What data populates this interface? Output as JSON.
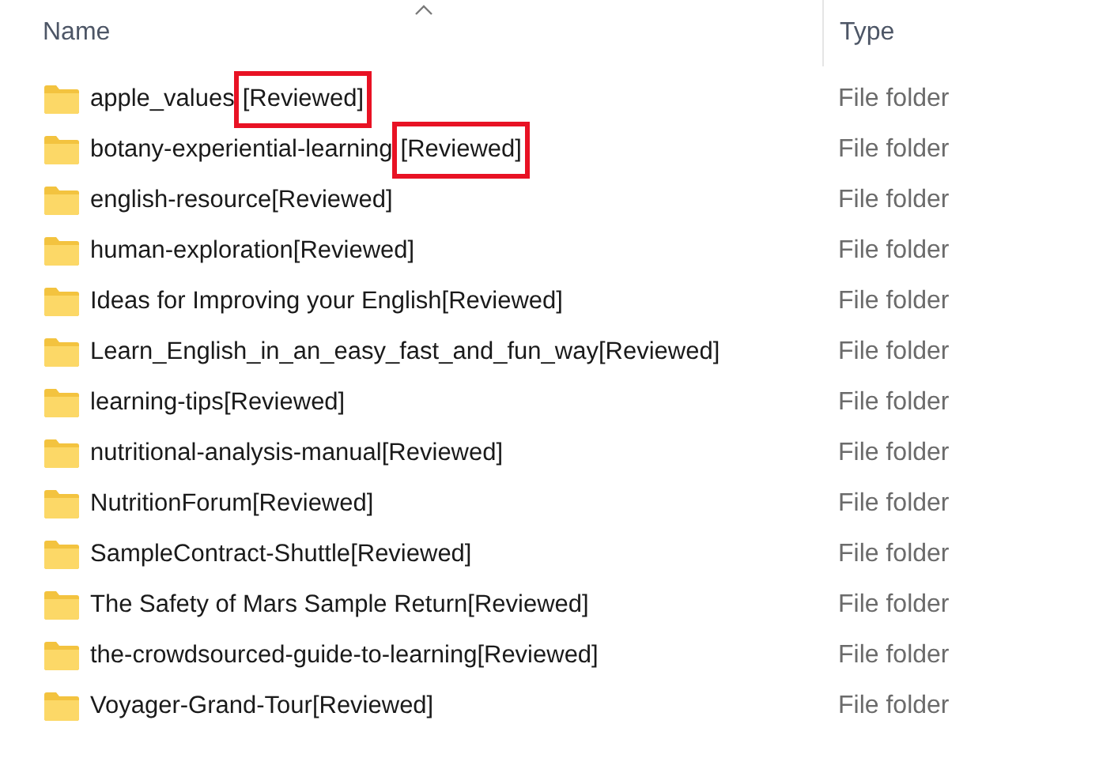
{
  "columns": [
    {
      "label": "Name",
      "sorted": true
    },
    {
      "label": "Type",
      "sorted": false
    }
  ],
  "rows": [
    {
      "name": "apple_values",
      "tag": "[Reviewed]",
      "type": "File folder",
      "highlighted": true
    },
    {
      "name": "botany-experiential-learning",
      "tag": "[Reviewed]",
      "type": "File folder",
      "highlighted": true
    },
    {
      "name": "english-resource",
      "tag": "[Reviewed]",
      "type": "File folder",
      "highlighted": false
    },
    {
      "name": "human-exploration",
      "tag": "[Reviewed]",
      "type": "File folder",
      "highlighted": false
    },
    {
      "name": "Ideas for Improving your English",
      "tag": "[Reviewed]",
      "type": "File folder",
      "highlighted": false
    },
    {
      "name": "Learn_English_in_an_easy_fast_and_fun_way",
      "tag": "[Reviewed]",
      "type": "File folder",
      "highlighted": false
    },
    {
      "name": "learning-tips",
      "tag": "[Reviewed]",
      "type": "File folder",
      "highlighted": false
    },
    {
      "name": "nutritional-analysis-manual",
      "tag": "[Reviewed]",
      "type": "File folder",
      "highlighted": false
    },
    {
      "name": "NutritionForum",
      "tag": "[Reviewed]",
      "type": "File folder",
      "highlighted": false
    },
    {
      "name": "SampleContract-Shuttle",
      "tag": "[Reviewed]",
      "type": "File folder",
      "highlighted": false
    },
    {
      "name": "The Safety of Mars Sample Return",
      "tag": "[Reviewed]",
      "type": "File folder",
      "highlighted": false
    },
    {
      "name": "the-crowdsourced-guide-to-learning",
      "tag": "[Reviewed]",
      "type": "File folder",
      "highlighted": false
    },
    {
      "name": "Voyager-Grand-Tour",
      "tag": "[Reviewed]",
      "type": "File folder",
      "highlighted": false
    }
  ]
}
